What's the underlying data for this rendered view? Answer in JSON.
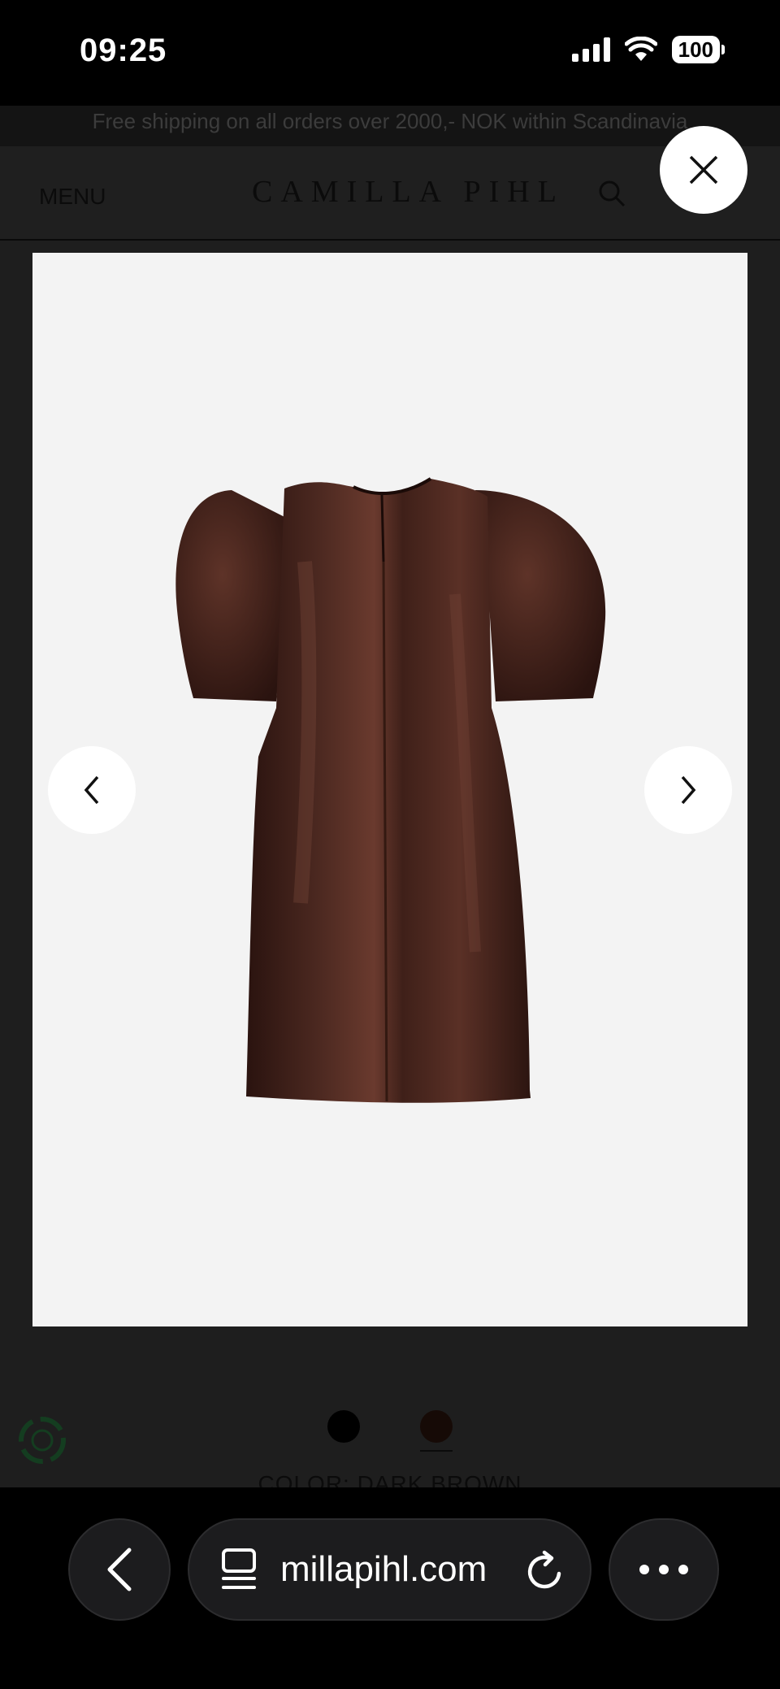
{
  "status_bar": {
    "time": "09:25",
    "battery": "100",
    "icons": [
      "cellular-signal-icon",
      "wifi-icon",
      "battery-icon"
    ]
  },
  "website": {
    "promo_text": "Free shipping on all orders over 2000,- NOK within Scandinavia",
    "menu_label": "MENU",
    "logo_text": "CAMILLA PIHL",
    "color_label": "COLOR: DARK BROWN",
    "swatches": [
      {
        "color": "#000000"
      },
      {
        "color": "#160a06",
        "selected": true
      }
    ]
  },
  "lightbox": {
    "product": "dark brown satin puff-sleeve mini dress",
    "icons": [
      "close-icon",
      "chevron-left-icon",
      "chevron-right-icon"
    ]
  },
  "browser": {
    "url": "millapihl.com",
    "icons": [
      "back-icon",
      "tab-overview-icon",
      "reload-icon",
      "more-icon"
    ]
  },
  "colors": {
    "background_dim": "#1e1e1e",
    "image_background": "#f3f3f3",
    "dress": "#3a1d17"
  }
}
